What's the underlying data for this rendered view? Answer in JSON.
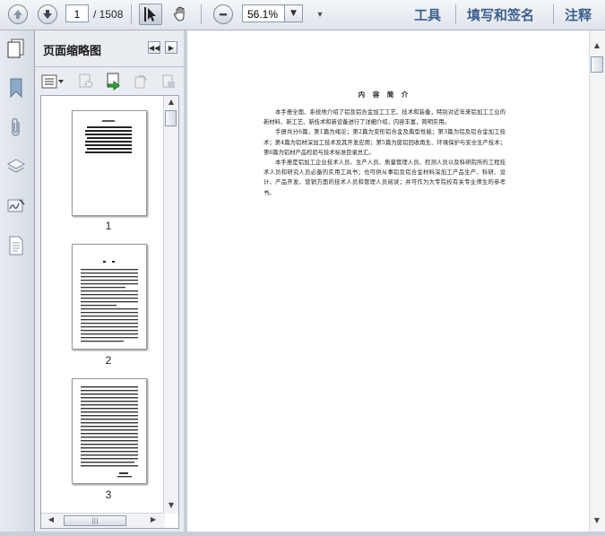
{
  "toolbar": {
    "current_page": "1",
    "total_pages": "/ 1508",
    "zoom": "56.1%",
    "tools_label": "工具",
    "sign_label": "填写和签名",
    "comment_label": "注释"
  },
  "panel": {
    "title": "页面缩略图",
    "thumbnails": [
      {
        "label": "1"
      },
      {
        "label": "2"
      },
      {
        "label": "3"
      }
    ]
  },
  "document": {
    "title": "内 容 简 介",
    "paragraphs": [
      "本手册全面、系统地介绍了铝及铝合金加工工艺、技术和装备，特别对近年来铝加工工业的新材料、新工艺、新技术和新设备进行了详细介绍，内容丰富，简明实用。",
      "手册共分6篇，第1篇为绪论；第2篇为变形铝合金及典型性能；第3篇为铝及铝合金加工技术；第4篇为铝材深加工技术及其开发应用；第5篇为废铝回收再生、环境保护与安全生产技术；第6篇为铝材产品检验与技术标准目录总汇。",
      "本手册是铝加工企业技术人员、生产人员、质量管理人员、检测人员以及科研院所的工程技术人员和研究人员必备的实用工具书；也可供从事铝及铝合金材料深加工产品生产、科研、设计、产品开发、营销方面的技术人员和管理人员阅读；并可作为大专院校有关专业师生的参考书。"
    ]
  },
  "icons": {
    "prev_page": "arrow-up-icon",
    "next_page": "arrow-down-icon",
    "select_tool": "cursor-icon",
    "hand_tool": "hand-icon",
    "zoom_out": "minus-icon"
  },
  "colors": {
    "toolbar_link": "#3c5f8c",
    "doc_background": "#ffffff",
    "panel_background": "#e9edf2"
  }
}
